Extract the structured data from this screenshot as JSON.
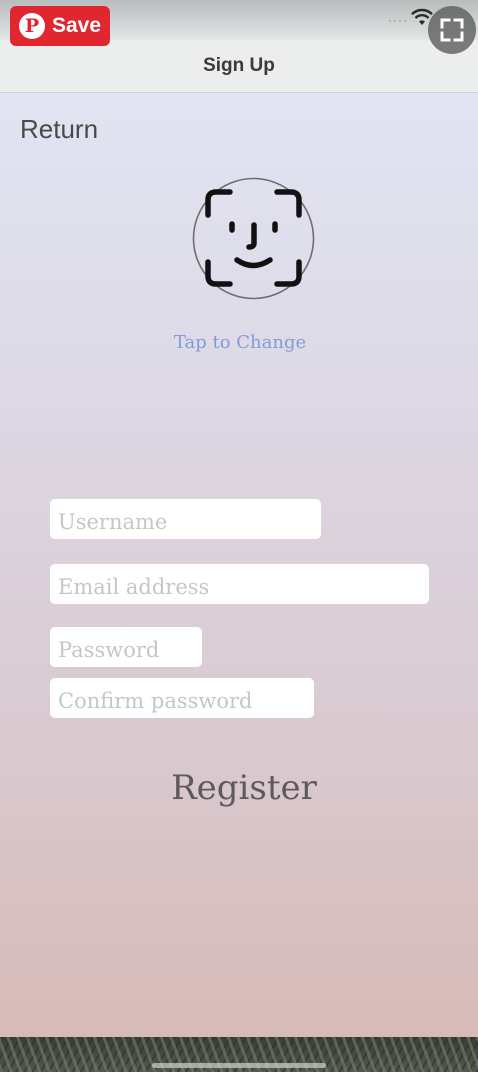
{
  "overlay": {
    "save_label": "Save",
    "pin_glyph": "P",
    "pin_icon": "pinterest-logo-icon",
    "fullscreen_icon": "expand-icon"
  },
  "status_bar": {
    "signal_dots": "····",
    "wifi_icon": "wifi-icon"
  },
  "nav": {
    "title": "Sign Up"
  },
  "return_label": "Return",
  "avatar": {
    "icon": "face-id-icon",
    "change_label": "Tap to Change"
  },
  "form": {
    "username_placeholder": "Username",
    "email_placeholder": "Email address",
    "password_placeholder": "Password",
    "confirm_placeholder": "Confirm password",
    "register_label": "Register"
  },
  "colors": {
    "pin_red": "#e0262f",
    "link_blue": "#7d9ed6",
    "gradient_top": "#e3e8f6",
    "gradient_bottom": "#d6b9b5"
  }
}
